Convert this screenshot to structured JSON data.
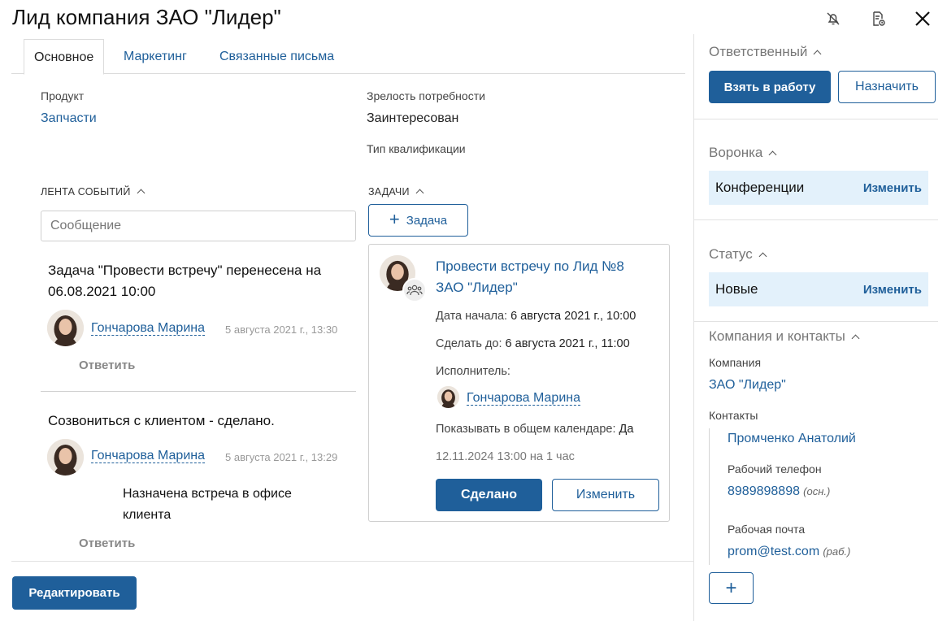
{
  "header": {
    "title": "Лид компания ЗАО \"Лидер\"",
    "icons": [
      "bell-off-icon",
      "document-settings-icon",
      "close-icon"
    ]
  },
  "tabs": [
    {
      "label": "Основное",
      "active": true
    },
    {
      "label": "Маркетинг",
      "active": false
    },
    {
      "label": "Связанные письма",
      "active": false
    }
  ],
  "fields": {
    "product_label": "Продукт",
    "product_value": "Запчасти",
    "maturity_label": "Зрелость потребности",
    "maturity_value": "Заинтересован",
    "qualification_label": "Тип квалификации"
  },
  "feed": {
    "title": "ЛЕНТА СОБЫТИЙ",
    "message_placeholder": "Сообщение",
    "events": [
      {
        "text": "Задача \"Провести встречу\" перенесена на 06.08.2021 10:00",
        "author": "Гончарова Марина",
        "date": "5 августа 2021 г., 13:30",
        "reply": "Ответить"
      },
      {
        "text": "Созвониться с клиентом - сделано.",
        "author": "Гончарова Марина",
        "date": "5 августа 2021 г., 13:29",
        "comment": "Назначена встреча в офисе клиента",
        "reply": "Ответить"
      }
    ]
  },
  "tasks": {
    "title": "ЗАДАЧИ",
    "add_label": "Задача",
    "card": {
      "title": "Провести встречу по Лид №8 ЗАО \"Лидер\"",
      "start_label": "Дата начала:",
      "start_value": "6 августа 2021 г., 10:00",
      "due_label": "Сделать до:",
      "due_value": "6 августа 2021 г., 11:00",
      "assignee_label": "Исполнитель:",
      "assignee": "Гончарова Марина",
      "calendar_label": "Показывать в общем календаре:",
      "calendar_value": "Да",
      "meta": "12.11.2024 13:00 на 1 час",
      "done_label": "Сделано",
      "change_label": "Изменить"
    }
  },
  "footer": {
    "edit_label": "Редактировать"
  },
  "sidebar": {
    "responsible": {
      "title": "Ответственный",
      "take_label": "Взять в работу",
      "assign_label": "Назначить"
    },
    "funnel": {
      "title": "Воронка",
      "value": "Конференции",
      "change_label": "Изменить"
    },
    "status": {
      "title": "Статус",
      "value": "Новые",
      "change_label": "Изменить"
    },
    "company": {
      "title": "Компания и контакты",
      "company_label": "Компания",
      "company_value": "ЗАО \"Лидер\"",
      "contacts_label": "Контакты",
      "contact_name": "Промченко Анатолий",
      "phone_label": "Рабочий телефон",
      "phone_value": "8989898898",
      "phone_note": "(осн.)",
      "email_label": "Рабочая почта",
      "email_value": "prom@test.com",
      "email_note": "(раб.)",
      "add_label": "+"
    }
  },
  "colors": {
    "accent": "#1f5f9a",
    "highlight": "#e3f1fb"
  }
}
